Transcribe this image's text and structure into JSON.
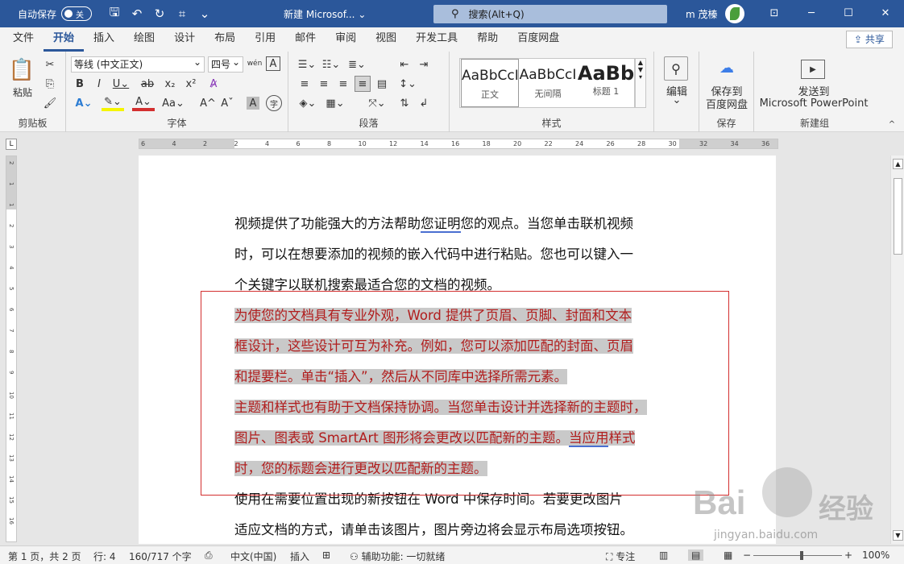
{
  "titlebar": {
    "autosave_label": "自动保存",
    "autosave_state": "关",
    "doc_title": "新建 Microsof...",
    "search_text": "搜索(Alt+Q)",
    "user_name": "m 茂榛",
    "qat_icons": [
      "save-icon",
      "undo-icon",
      "redo-icon",
      "touch-mode-icon",
      "customize-icon"
    ]
  },
  "tabs": [
    "文件",
    "开始",
    "插入",
    "绘图",
    "设计",
    "布局",
    "引用",
    "邮件",
    "审阅",
    "视图",
    "开发工具",
    "帮助",
    "百度网盘"
  ],
  "share_label": "共享",
  "ribbon": {
    "clipboard": {
      "paste": "粘贴",
      "label": "剪贴板"
    },
    "font": {
      "name": "等线 (中文正文)",
      "size": "四号",
      "label": "字体"
    },
    "paragraph": {
      "label": "段落"
    },
    "styles": {
      "label": "样式",
      "items": [
        {
          "preview": "AaBbCcI",
          "name": "正文"
        },
        {
          "preview": "AaBbCcI",
          "name": "无间隔"
        },
        {
          "preview": "AaBb",
          "name": "标题 1"
        }
      ]
    },
    "edit": {
      "label": "编辑"
    },
    "save": {
      "btn": "保存到\n百度网盘",
      "btn1": "保存到",
      "btn2": "百度网盘",
      "label": "保存"
    },
    "send": {
      "btn1": "发送到",
      "btn2": "Microsoft PowerPoint",
      "label": "新建组"
    }
  },
  "ruler": {
    "h_ticks": [
      "6",
      "4",
      "2",
      "2",
      "4",
      "6",
      "8",
      "10",
      "12",
      "14",
      "16",
      "18",
      "20",
      "22",
      "24",
      "26",
      "28",
      "30",
      "32",
      "34",
      "36"
    ],
    "v_ticks": [
      "2",
      "1",
      "1",
      "2",
      "3",
      "4",
      "5",
      "6",
      "7",
      "8",
      "9",
      "10",
      "11",
      "12",
      "13",
      "14",
      "15",
      "16"
    ]
  },
  "document": {
    "p1": [
      "视频提供了功能强大的方法帮助",
      "您证明",
      "您的观点。当您单击联机视频",
      "时，可以在想要添加的视频的嵌入代码中进行粘贴。您也可以键入一",
      "个关键字以联机搜索最适合您的文档的视频。"
    ],
    "p2": [
      "为使您的文档具有专业外观，Word 提供了页眉、页脚、封面和文本",
      "框设计，这些设计可互为补充。例如，您可以添加匹配的封面、页眉",
      "和提要栏。单击“插入”，然后从不同库中选择所需元素。"
    ],
    "p3": [
      "主题和样式也有助于文档保持协调。当您单击设计并选择新的主题时，",
      "图片、图表或 SmartArt 图形将会更改以匹配新的主题。",
      "当应用",
      "样式",
      "时，您的标题会进行更改以匹配新的主题。"
    ],
    "p4": [
      "使用在需要位置出现的新按钮在 Word 中保存时间。若要更改图片",
      "适应文档的方式，请单击该图片，图片旁边将会显示布局选项按钮。"
    ]
  },
  "status": {
    "page": "第 1 页，共 2 页",
    "line": "行: 4",
    "words": "160/717 个字",
    "lang": "中文(中国)",
    "insert": "插入",
    "accessibility": "辅助功能: 一切就绪",
    "focus": "专注",
    "zoom": "100%"
  },
  "watermark": {
    "brand1": "Bai",
    "brand2": "经验",
    "url": "jingyan.baidu.com"
  },
  "colors": {
    "titlebar": "#2b579a",
    "selection_text": "#b11d1d",
    "highlight": "#c9c9c9"
  }
}
